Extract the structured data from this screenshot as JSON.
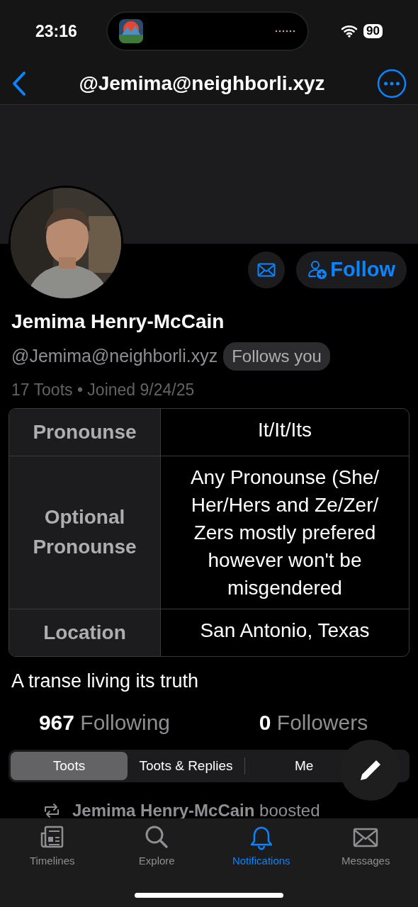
{
  "status_bar": {
    "time": "23:16",
    "battery": "90"
  },
  "nav": {
    "title": "@Jemima@neighborli.xyz"
  },
  "profile": {
    "display_name": "Jemima Henry-McCain",
    "handle": "@Jemima@neighborli.xyz",
    "follows_you": "Follows you",
    "meta": "17 Toots • Joined 9/24/25",
    "follow_button": "Follow",
    "fields": [
      {
        "label": "Pronounse",
        "value": "It/It/Its"
      },
      {
        "label": "Optional Pronounse",
        "value": "Any Pronounse (She/ Her/Hers and Ze/Zer/ Zers mostly prefered however won't be misgendered"
      },
      {
        "label": "Location",
        "value": "San Antonio, Texas"
      }
    ],
    "bio": "A transe living its truth",
    "following": {
      "count": "967",
      "label": "Following"
    },
    "followers": {
      "count": "0",
      "label": "Followers"
    }
  },
  "segments": [
    {
      "label": "Toots",
      "selected": true
    },
    {
      "label": "Toots & Replies",
      "selected": false
    },
    {
      "label": "Me",
      "selected": false
    }
  ],
  "boost": {
    "name": "Jemima Henry-McCain",
    "action": "boosted"
  },
  "tab_bar": [
    {
      "label": "Timelines",
      "selected": false
    },
    {
      "label": "Explore",
      "selected": false
    },
    {
      "label": "Notifications",
      "selected": true
    },
    {
      "label": "Messages",
      "selected": false
    }
  ]
}
